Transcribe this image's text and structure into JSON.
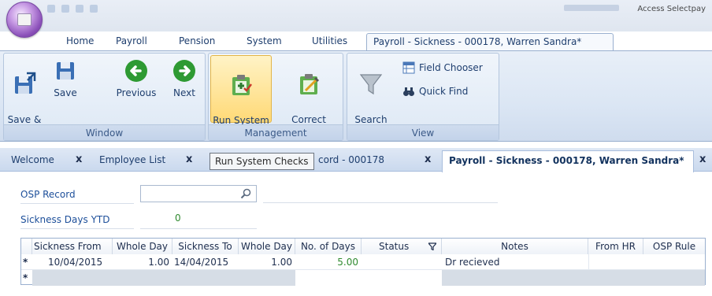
{
  "window": {
    "title_right": "Access Selectpay"
  },
  "ribbon_tabs": [
    "Home",
    "Payroll",
    "Pension",
    "System",
    "Utilities",
    "Payroll - Sickness - 000178, Warren Sandra*"
  ],
  "ribbon": {
    "window_group": {
      "label": "Window",
      "save_close": "Save &\nClose",
      "save": "Save",
      "previous": "Previous",
      "next": "Next"
    },
    "management_group": {
      "label": "Management",
      "run_checks": "Run System\nChecks",
      "correct_sickness": "Correct\nSickness"
    },
    "view_group": {
      "label": "View",
      "search_criteria": "Search\nCriteria",
      "field_chooser": "Field Chooser",
      "quick_find": "Quick Find"
    }
  },
  "doc_tabs": {
    "welcome": "Welcome",
    "employee_list": "Employee List",
    "partial": "cord - 000178",
    "active": "Payroll - Sickness - 000178, Warren Sandra*",
    "close_glyph": "x"
  },
  "tooltip": "Run System Checks",
  "form": {
    "osp_record_label": "OSP Record",
    "osp_record_value": "",
    "sickness_ytd_label": "Sickness Days YTD",
    "sickness_ytd_value": "0"
  },
  "grid": {
    "headers": [
      "Sickness From",
      "Whole Day",
      "Sickness To",
      "Whole Day",
      "No. of Days",
      "Status",
      "Notes",
      "From HR",
      "OSP Rule"
    ],
    "rows": [
      {
        "marker": "*",
        "sickness_from": "10/04/2015",
        "whole_day_1": "1.00",
        "sickness_to": "14/04/2015",
        "whole_day_2": "1.00",
        "no_of_days": "5.00",
        "status": "",
        "notes": "Dr recieved",
        "from_hr": "",
        "osp_rule": ""
      }
    ],
    "new_row_marker": "*"
  },
  "colors": {
    "accent": "#1d4f9a",
    "positive": "#2f8a2f",
    "highlight": "#ffd976"
  }
}
